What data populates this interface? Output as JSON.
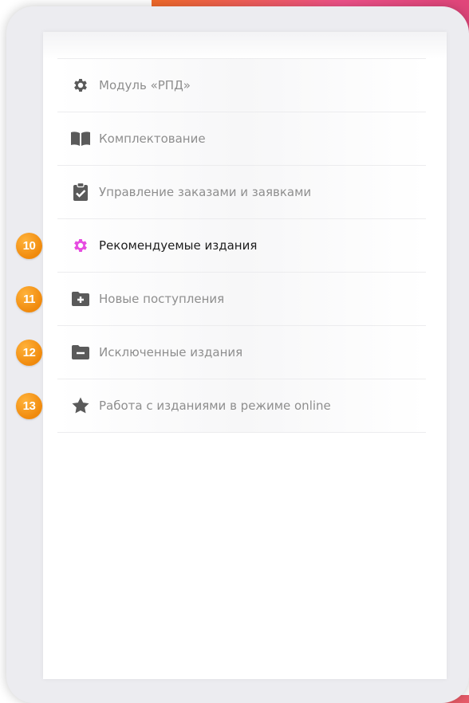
{
  "colors": {
    "icon_gray": "#5a5a5a",
    "active_icon": "#e64ce0",
    "badge": "#f39a15",
    "text_gray": "#8e8e8e",
    "text_active": "#1e1e1e"
  },
  "menu": {
    "items": [
      {
        "label": "Модуль «РПД»",
        "icon": "gear-icon"
      },
      {
        "label": "Комплектование",
        "icon": "book-icon"
      },
      {
        "label": "Управление заказами и заявками",
        "icon": "clipboard-check-icon"
      },
      {
        "label": "Рекомендуемые издания",
        "icon": "gear-icon",
        "active": true
      },
      {
        "label": "Новые поступления",
        "icon": "folder-plus-icon"
      },
      {
        "label": "Исключенные издания",
        "icon": "folder-minus-icon"
      },
      {
        "label": "Работа с изданиями в режиме online",
        "icon": "star-icon"
      }
    ]
  },
  "badges": [
    "10",
    "11",
    "12",
    "13"
  ]
}
